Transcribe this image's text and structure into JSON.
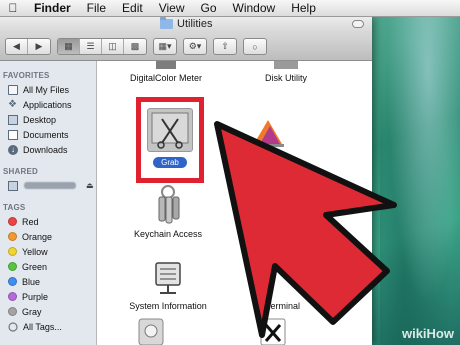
{
  "menubar": {
    "app": "Finder",
    "items": [
      "File",
      "Edit",
      "View",
      "Go",
      "Window",
      "Help"
    ]
  },
  "window": {
    "title": "Utilities"
  },
  "sidebar": {
    "favorites_heading": "FAVORITES",
    "favorites": [
      {
        "label": "All My Files",
        "icon": "all-files-icon"
      },
      {
        "label": "Applications",
        "icon": "applications-icon"
      },
      {
        "label": "Desktop",
        "icon": "desktop-icon"
      },
      {
        "label": "Documents",
        "icon": "documents-icon"
      },
      {
        "label": "Downloads",
        "icon": "downloads-icon"
      }
    ],
    "shared_heading": "SHARED",
    "tags_heading": "TAGS",
    "tags": [
      {
        "label": "Red",
        "color": "#e94545"
      },
      {
        "label": "Orange",
        "color": "#f39a2f"
      },
      {
        "label": "Yellow",
        "color": "#f2d42f"
      },
      {
        "label": "Green",
        "color": "#58c442"
      },
      {
        "label": "Blue",
        "color": "#3f8ef0"
      },
      {
        "label": "Purple",
        "color": "#b46ad7"
      },
      {
        "label": "Gray",
        "color": "#a3a3a3"
      }
    ],
    "all_tags": "All Tags..."
  },
  "content": {
    "items": [
      {
        "label": "DigitalColor Meter"
      },
      {
        "label": "Disk Utility"
      },
      {
        "label": "Grab",
        "selected": true
      },
      {
        "label": "Keychain Access"
      },
      {
        "label": "System Information"
      },
      {
        "label": "Terminal"
      }
    ]
  },
  "watermark": {
    "brand": "wiki",
    "suffix": "How"
  },
  "colors": {
    "highlight": "#e0212f",
    "arrow": "#dd2a35",
    "selection": "#2f64c9"
  }
}
